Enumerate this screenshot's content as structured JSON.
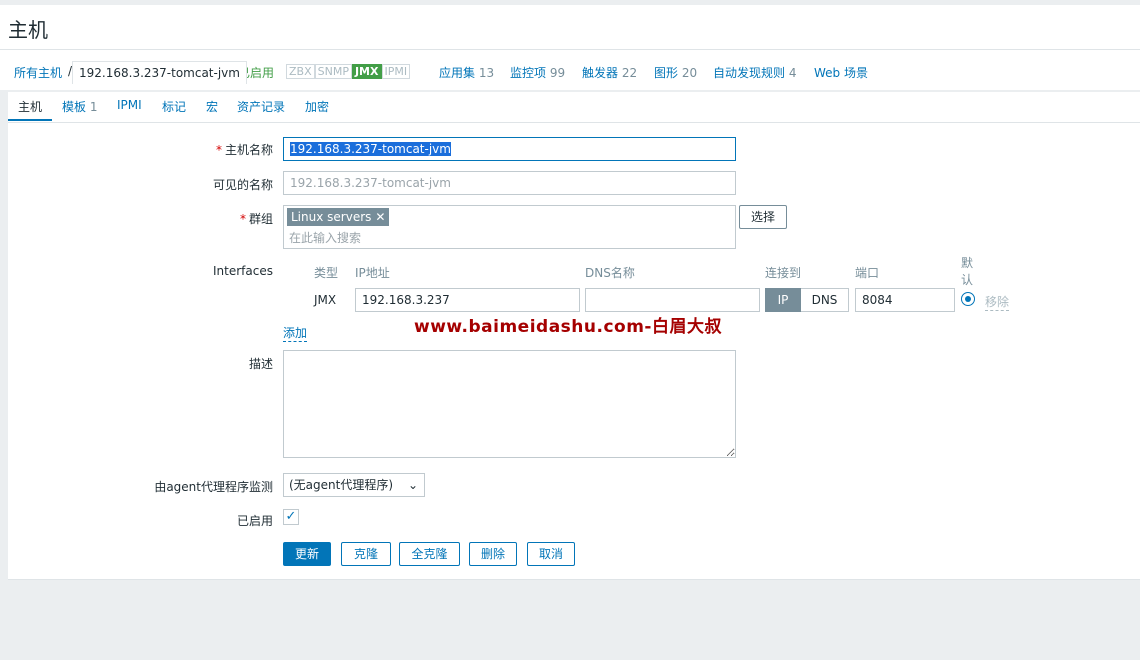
{
  "header": {
    "title": "主机"
  },
  "breadcrumb": {
    "all_hosts": "所有主机",
    "separator": "/",
    "current_host": "192.168.3.237-tomcat-jvm",
    "status": "已启用",
    "availability": [
      "ZBX",
      "SNMP",
      "JMX",
      "IPMI"
    ],
    "active_availability": "JMX",
    "links": [
      {
        "label": "应用集",
        "count": "13"
      },
      {
        "label": "监控项",
        "count": "99"
      },
      {
        "label": "触发器",
        "count": "22"
      },
      {
        "label": "图形",
        "count": "20"
      },
      {
        "label": "自动发现规则",
        "count": "4"
      },
      {
        "label": "Web 场景",
        "count": ""
      }
    ]
  },
  "tabs": [
    {
      "label": "主机",
      "count": ""
    },
    {
      "label": "模板",
      "count": "1"
    },
    {
      "label": "IPMI",
      "count": ""
    },
    {
      "label": "标记",
      "count": ""
    },
    {
      "label": "宏",
      "count": ""
    },
    {
      "label": "资产记录",
      "count": ""
    },
    {
      "label": "加密",
      "count": ""
    }
  ],
  "form": {
    "host_name_label": "主机名称",
    "host_name_value": "192.168.3.237-tomcat-jvm",
    "visible_name_label": "可见的名称",
    "visible_name_placeholder": "192.168.3.237-tomcat-jvm",
    "groups_label": "群组",
    "group_chip": "Linux servers",
    "group_search_placeholder": "在此输入搜索",
    "select_button": "选择",
    "interfaces_label": "Interfaces",
    "interface_headers": {
      "type": "类型",
      "ip": "IP地址",
      "dns": "DNS名称",
      "connect_to": "连接到",
      "port": "端口",
      "default_line1": "默",
      "default_line2": "认"
    },
    "interface": {
      "type": "JMX",
      "ip": "192.168.3.237",
      "dns": "",
      "connect_ip": "IP",
      "connect_dns": "DNS",
      "connect_selected": "IP",
      "port": "8084",
      "remove": "移除"
    },
    "add_link": "添加",
    "description_label": "描述",
    "description_value": "",
    "proxy_label": "由agent代理程序监测",
    "proxy_value": "(无agent代理程序)",
    "enabled_label": "已启用",
    "enabled": true
  },
  "buttons": {
    "update": "更新",
    "clone": "克隆",
    "full_clone": "全克隆",
    "delete": "删除",
    "cancel": "取消"
  },
  "watermark": "www.baimeidashu.com-白眉大叔",
  "colors": {
    "accent": "#0275b8",
    "enabled_green": "#429e47",
    "required_red": "#d40000",
    "chip_grey": "#768d99",
    "watermark_red": "#a50000"
  }
}
